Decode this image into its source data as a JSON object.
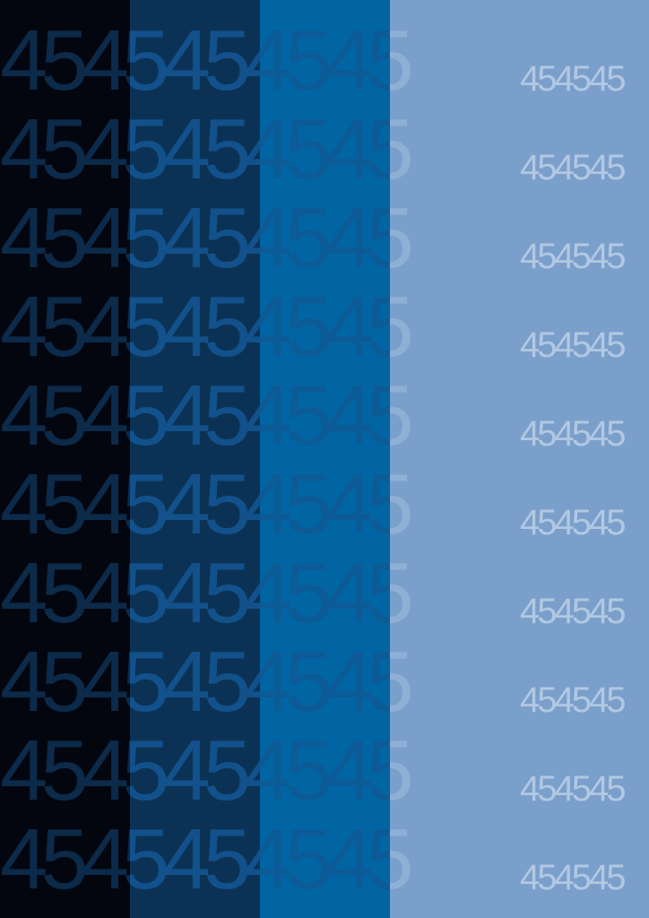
{
  "pattern": {
    "repeat_text": "4545454545",
    "small_text": "454545",
    "row_count": 10
  },
  "colors": {
    "band_1": "#03060f",
    "band_2": "#0b3255",
    "band_3": "#0165a3",
    "band_4": "#7a9fcb",
    "digits_dark": "#0c2a49",
    "digits_mid": "#12518b",
    "digits_blue": "#0d5b96",
    "digits_faint": "#8fb0d5",
    "digits_light": "#b2c8e2"
  }
}
